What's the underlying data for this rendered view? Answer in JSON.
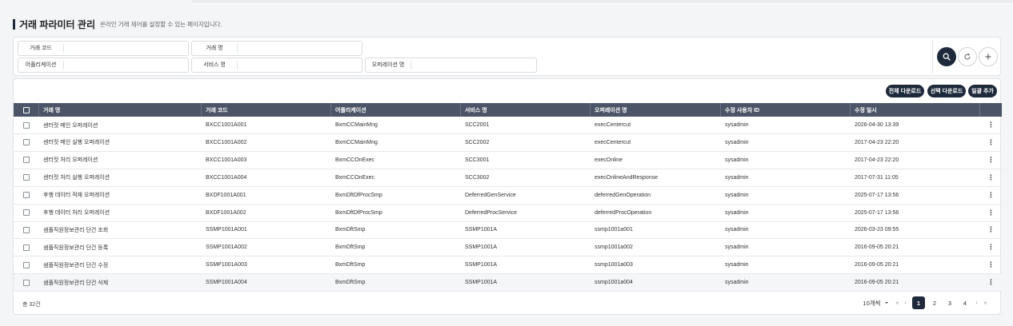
{
  "page": {
    "title": "거래 파라미터 관리",
    "description": "온라인 거래 제어를 설정할 수 있는 페이지입니다."
  },
  "search": {
    "fields": [
      {
        "label": "거래 코드",
        "value": ""
      },
      {
        "label": "거래 명",
        "value": ""
      },
      {
        "label": "어플리케이션",
        "value": ""
      },
      {
        "label": "서비스 명",
        "value": ""
      },
      {
        "label": "오퍼레이션 명",
        "value": ""
      }
    ],
    "buttons": {
      "search": "search-icon",
      "reset": "refresh-icon",
      "add": "plus-icon"
    }
  },
  "actions": {
    "download_all": "전체 다운로드",
    "download_selected": "선택 다운로드",
    "bulk_add": "일괄 추가"
  },
  "table": {
    "columns": [
      "거래 명",
      "거래 코드",
      "어플리케이션",
      "서비스 명",
      "오퍼레이션 명",
      "수정 사용자 ID",
      "수정 일시"
    ],
    "rows": [
      [
        "센터컷 메인 오퍼레이션",
        "BXCC1001A001",
        "BxmCCMainMng",
        "SCC2001",
        "execCentercut",
        "sysadmin",
        "2026-04-30 13:39"
      ],
      [
        "센터컷 메인 실행 오퍼레이션",
        "BXCC1001A002",
        "BxmCCMainMng",
        "SCC2002",
        "execCentercut",
        "sysadmin",
        "2017-04-23 22:20"
      ],
      [
        "센터컷 처리 오퍼레이션",
        "BXCC1001A003",
        "BxmCCOnExec",
        "SCC3001",
        "execOnline",
        "sysadmin",
        "2017-04-23 22:20"
      ],
      [
        "센터컷 처리 실행 오퍼레이션",
        "BXCC1001A004",
        "BxmCCOnExec",
        "SCC3002",
        "execOnlineAndResponse",
        "sysadmin",
        "2017-07-31 11:05"
      ],
      [
        "후행 데이터 적재 오퍼레이션",
        "BXDF1001A001",
        "BxmDftDfProcSmp",
        "DeferredGenService",
        "deferredGenOperation",
        "sysadmin",
        "2025-07-17 13:56"
      ],
      [
        "후행 데이터 처리 오퍼레이션",
        "BXDF1001A002",
        "BxmDftDfProcSmp",
        "DeferredProcService",
        "deferredProcOperation",
        "sysadmin",
        "2025-07-17 13:56"
      ],
      [
        "샘플직원정보관리 단건 조회",
        "SSMP1001A001",
        "BxmDftSmp",
        "SSMP1001A",
        "ssmp1001a001",
        "sysadmin",
        "2026-03-23 09:55"
      ],
      [
        "샘플직원정보관리 단건 등록",
        "SSMP1001A002",
        "BxmDftSmp",
        "SSMP1001A",
        "ssmp1001a002",
        "sysadmin",
        "2016-09-05 20:21"
      ],
      [
        "샘플직원정보관리 단건 수정",
        "SSMP1001A003",
        "BxmDftSmp",
        "SSMP1001A",
        "ssmp1001a003",
        "sysadmin",
        "2016-09-05 20:21"
      ],
      [
        "샘플직원정보관리 단건 삭제",
        "SSMP1001A004",
        "BxmDftSmp",
        "SSMP1001A",
        "ssmp1001a004",
        "sysadmin",
        "2016-09-05 20:21"
      ]
    ]
  },
  "footer": {
    "total": "총 32건",
    "page_size": "10개씩",
    "pages": [
      "1",
      "2",
      "3",
      "4"
    ],
    "current_page": "1",
    "nav": {
      "first": "«",
      "prev": "‹",
      "next": "›",
      "last": "»"
    }
  },
  "colors": {
    "primary": "#1e2a3b",
    "header_bg": "#4b5567"
  }
}
